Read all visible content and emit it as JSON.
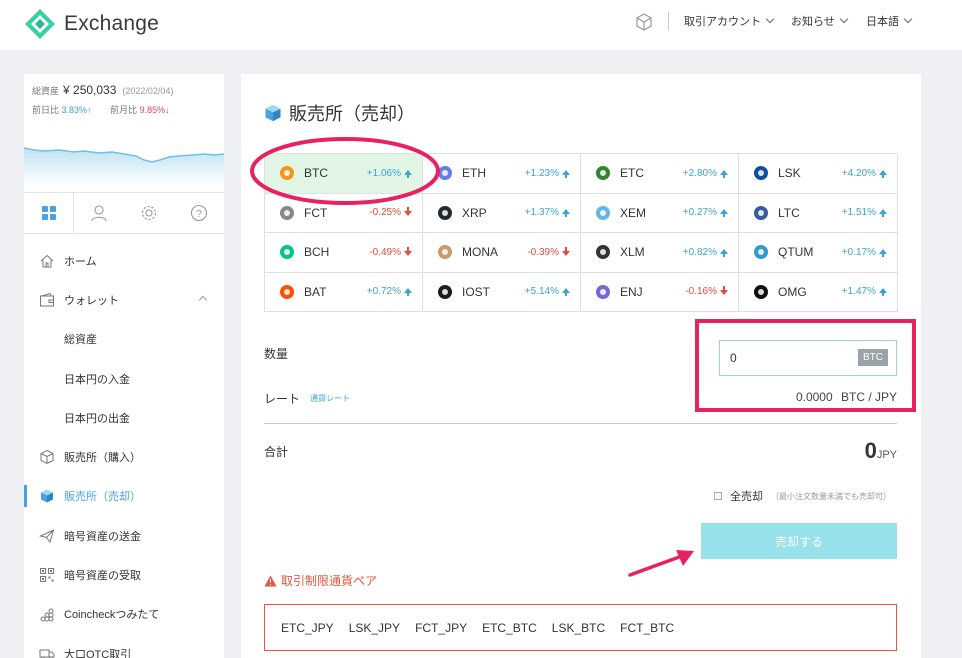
{
  "header": {
    "logo_text": "Exchange",
    "menu": [
      {
        "label": "取引アカウント"
      },
      {
        "label": "お知らせ"
      },
      {
        "label": "日本語"
      }
    ]
  },
  "sidebar": {
    "asset_label": "総資産",
    "asset_value": "¥ 250,033",
    "asset_date": "(2022/02/04)",
    "day_label": "前日比",
    "day_change": "3.83%↑",
    "month_label": "前月比",
    "month_change": "9.85%↓",
    "tabs": [
      {
        "icon": "grid-icon"
      },
      {
        "icon": "user-icon"
      },
      {
        "icon": "gear-icon"
      },
      {
        "icon": "help-icon"
      }
    ],
    "nav": [
      {
        "label": "ホーム",
        "icon": "home-icon"
      },
      {
        "label": "ウォレット",
        "icon": "wallet-icon"
      },
      {
        "label": "総資産"
      },
      {
        "label": "日本円の入金"
      },
      {
        "label": "日本円の出金"
      },
      {
        "label": "販売所（購入）",
        "icon": "cube-outline-icon"
      },
      {
        "label": "販売所（売却）",
        "icon": "cube-icon"
      },
      {
        "label": "暗号資産の送金",
        "icon": "send-icon"
      },
      {
        "label": "暗号資産の受取",
        "icon": "qr-icon"
      },
      {
        "label": "Coincheckつみたて",
        "icon": "stack-icon"
      },
      {
        "label": "大口OTC取引",
        "icon": "truck-icon"
      }
    ]
  },
  "main": {
    "title": "販売所（売却）",
    "coins": [
      {
        "symbol": "BTC",
        "change": "+1.06%",
        "dir": "up",
        "color": "#f7931a",
        "selected": true
      },
      {
        "symbol": "ETH",
        "change": "+1.23%",
        "dir": "up",
        "color": "#627eea"
      },
      {
        "symbol": "ETC",
        "change": "+2.80%",
        "dir": "up",
        "color": "#328332"
      },
      {
        "symbol": "LSK",
        "change": "+4.20%",
        "dir": "up",
        "color": "#0d4ea0"
      },
      {
        "symbol": "FCT",
        "change": "-0.25%",
        "dir": "down",
        "color": "#888888"
      },
      {
        "symbol": "XRP",
        "change": "+1.37%",
        "dir": "up",
        "color": "#23292f"
      },
      {
        "symbol": "XEM",
        "change": "+0.27%",
        "dir": "up",
        "color": "#67b2e8"
      },
      {
        "symbol": "LTC",
        "change": "+1.51%",
        "dir": "up",
        "color": "#345d9d"
      },
      {
        "symbol": "BCH",
        "change": "-0.49%",
        "dir": "down",
        "color": "#0ac18e"
      },
      {
        "symbol": "MONA",
        "change": "-0.39%",
        "dir": "down",
        "color": "#c89d6b"
      },
      {
        "symbol": "XLM",
        "change": "+0.82%",
        "dir": "up",
        "color": "#333333"
      },
      {
        "symbol": "QTUM",
        "change": "+0.17%",
        "dir": "up",
        "color": "#2e9ad0"
      },
      {
        "symbol": "BAT",
        "change": "+0.72%",
        "dir": "up",
        "color": "#ff5000"
      },
      {
        "symbol": "IOST",
        "change": "+5.14%",
        "dir": "up",
        "color": "#1c1c1c"
      },
      {
        "symbol": "ENJ",
        "change": "-0.16%",
        "dir": "down",
        "color": "#7866d5"
      },
      {
        "symbol": "OMG",
        "change": "+1.47%",
        "dir": "up",
        "color": "#101010"
      }
    ],
    "quantity_label": "数量",
    "quantity_value": "0",
    "quantity_unit": "BTC",
    "rate_label": "レート",
    "rate_link": "通貨レート",
    "rate_value": "0.0000",
    "rate_unit": "BTC / JPY",
    "total_label": "合計",
    "total_value": "0",
    "total_unit": "JPY",
    "sell_all_label": "全売却",
    "sell_all_note": "（最小注文数量未満でも売却可）",
    "sell_button": "売却する",
    "restriction_title": "取引制限通貨ペア",
    "restricted_pairs": [
      "ETC_JPY",
      "LSK_JPY",
      "FCT_JPY",
      "ETC_BTC",
      "LSK_BTC",
      "FCT_BTC"
    ]
  },
  "colors": {
    "accent": "#47a3e0",
    "brand": "#3ccfa6",
    "positive": "#3aa3d8",
    "negative": "#e64a3b",
    "highlight": "#e8215f",
    "selected_cell": "#e2f6e6",
    "sell_button": "#96e1ea"
  }
}
